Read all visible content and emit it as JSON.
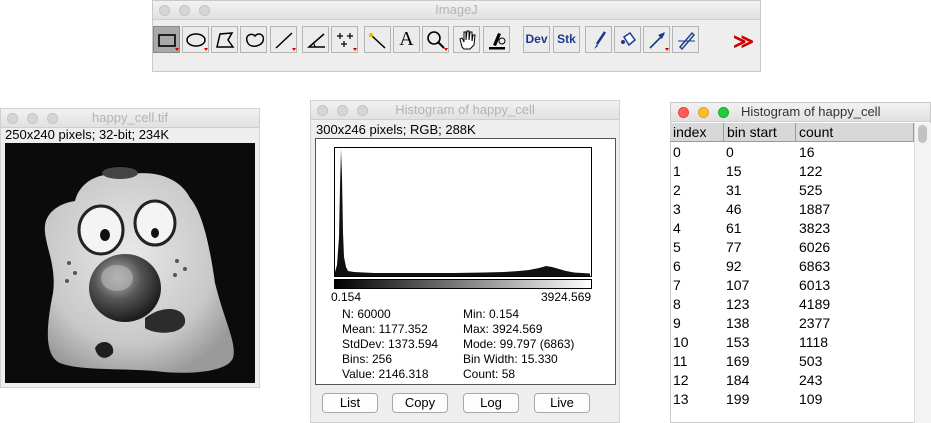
{
  "toolbar": {
    "title": "ImageJ",
    "tools": [
      {
        "name": "rectangle-tool",
        "icon": "rectangle-icon",
        "selected": true
      },
      {
        "name": "oval-tool",
        "icon": "oval-icon"
      },
      {
        "name": "polygon-tool",
        "icon": "polygon-icon"
      },
      {
        "name": "freehand-tool",
        "icon": "freehand-icon"
      },
      {
        "name": "line-tool",
        "icon": "line-icon"
      },
      {
        "name": "angle-tool",
        "icon": "angle-icon"
      },
      {
        "name": "multipoint-tool",
        "icon": "multipoint-icon"
      },
      {
        "name": "wand-tool",
        "icon": "wand-icon"
      },
      {
        "name": "text-tool",
        "icon": "text-icon",
        "label": "A"
      },
      {
        "name": "zoom-tool",
        "icon": "magnifier-icon"
      },
      {
        "name": "scroll-tool",
        "icon": "hand-icon"
      },
      {
        "name": "color-picker-tool",
        "icon": "microscope-icon"
      },
      {
        "name": "dev-menu-tool",
        "icon": "dev-icon",
        "label": "Dev"
      },
      {
        "name": "stk-menu-tool",
        "icon": "stack-icon",
        "label": "Stk"
      },
      {
        "name": "brush-tool",
        "icon": "brush-icon"
      },
      {
        "name": "flood-fill-tool",
        "icon": "bucket-icon"
      },
      {
        "name": "arrow-tool",
        "icon": "arrow-icon"
      },
      {
        "name": "pencil-tool",
        "icon": "pencil-icon"
      },
      {
        "name": "more-tools",
        "icon": "double-chevron-icon",
        "label": "≫"
      }
    ]
  },
  "image_window": {
    "title": "happy_cell.tif",
    "info": "250x240 pixels; 32-bit; 234K"
  },
  "histogram_window": {
    "title": "Histogram of happy_cell",
    "info": "300x246 pixels; RGB; 288K",
    "axis_min": "0.154",
    "axis_max": "3924.569",
    "stats": {
      "n": "N: 60000",
      "mean": "Mean: 1177.352",
      "stddev": "StdDev: 1373.594",
      "bins": "Bins: 256",
      "value": "Value: 2146.318",
      "min": "Min: 0.154",
      "max": "Max: 3924.569",
      "mode": "Mode: 99.797 (6863)",
      "bin_width": "Bin Width: 15.330",
      "count": "Count: 58"
    },
    "buttons": {
      "list": "List",
      "copy": "Copy",
      "log": "Log",
      "live": "Live"
    }
  },
  "table_window": {
    "title": "Histogram of happy_cell",
    "columns": [
      "index",
      "bin start",
      "count"
    ],
    "rows": [
      [
        "0",
        "0",
        "16"
      ],
      [
        "1",
        "15",
        "122"
      ],
      [
        "2",
        "31",
        "525"
      ],
      [
        "3",
        "46",
        "1887"
      ],
      [
        "4",
        "61",
        "3823"
      ],
      [
        "5",
        "77",
        "6026"
      ],
      [
        "6",
        "92",
        "6863"
      ],
      [
        "7",
        "107",
        "6013"
      ],
      [
        "8",
        "123",
        "4189"
      ],
      [
        "9",
        "138",
        "2377"
      ],
      [
        "10",
        "153",
        "1118"
      ],
      [
        "11",
        "169",
        "503"
      ],
      [
        "12",
        "184",
        "243"
      ],
      [
        "13",
        "199",
        "109"
      ]
    ]
  },
  "colors": {
    "close": "#ff5f57",
    "minimize": "#febc2e",
    "zoom": "#28c840",
    "dev_text": "#1a3a8f",
    "more_tools": "#cc0000"
  }
}
